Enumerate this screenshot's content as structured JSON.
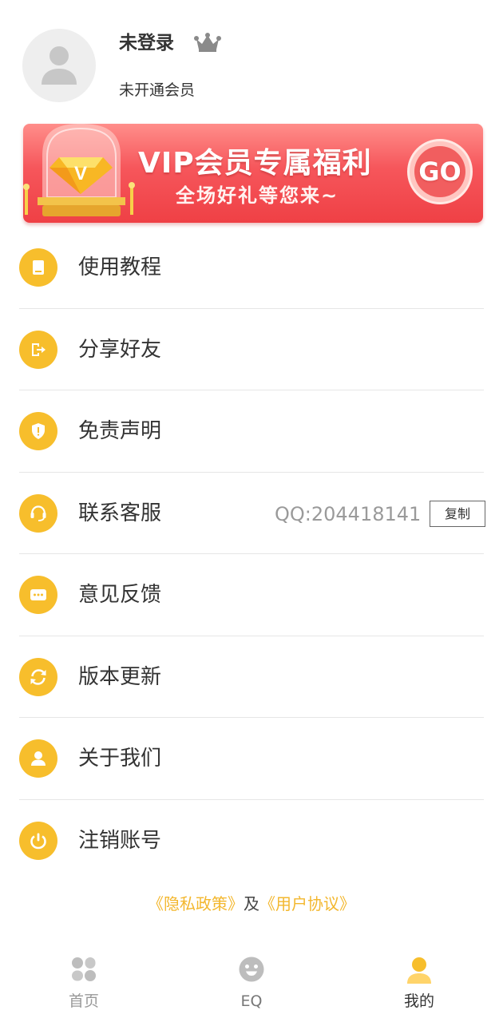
{
  "profile": {
    "username": "未登录",
    "vip_status": "未开通会员"
  },
  "banner": {
    "title": "VIP会员专属福利",
    "subtitle": "全场好礼等您来~",
    "go_label": "GO",
    "badge_letter": "V"
  },
  "menu": [
    {
      "label": "使用教程",
      "icon": "book-icon"
    },
    {
      "label": "分享好友",
      "icon": "share-icon"
    },
    {
      "label": "免责声明",
      "icon": "shield-icon"
    },
    {
      "label": "联系客服",
      "icon": "headset-icon",
      "qq": "QQ:204418141",
      "copy_label": "复制"
    },
    {
      "label": "意见反馈",
      "icon": "chat-icon"
    },
    {
      "label": "版本更新",
      "icon": "refresh-icon"
    },
    {
      "label": "关于我们",
      "icon": "person-icon"
    },
    {
      "label": "注销账号",
      "icon": "power-icon"
    }
  ],
  "footer": {
    "privacy": "《隐私政策》",
    "and": "及",
    "agreement": "《用户协议》"
  },
  "tabs": [
    {
      "label": "首页",
      "color": "#999999"
    },
    {
      "label": "EQ",
      "color": "#777777"
    },
    {
      "label": "我的",
      "color": "#333333"
    }
  ],
  "colors": {
    "accent": "#f7be2c",
    "banner": "#f6565b",
    "link": "#f3b72e"
  }
}
